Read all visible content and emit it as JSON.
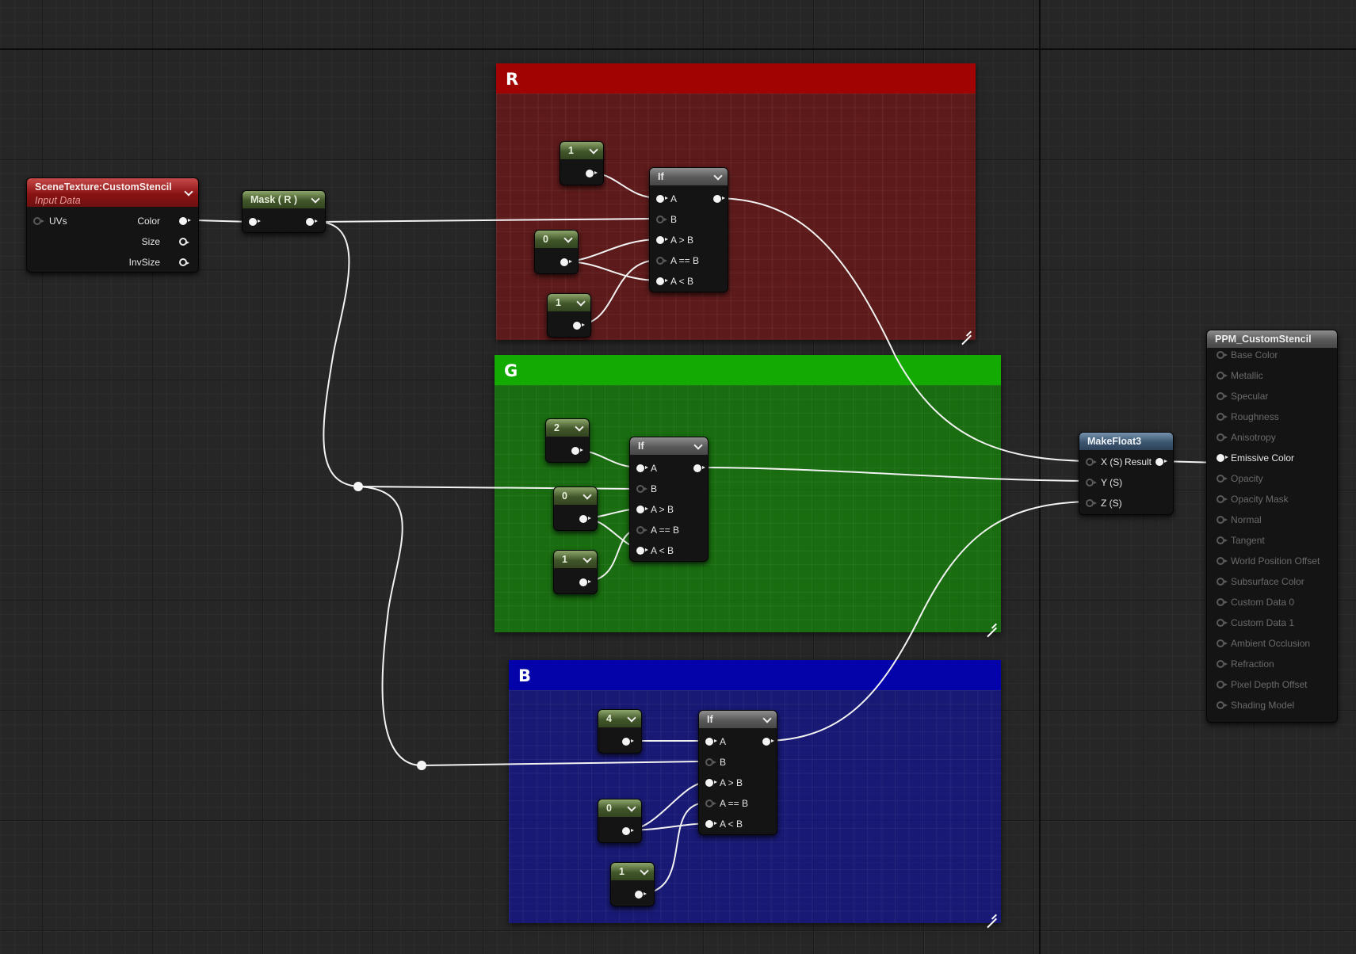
{
  "comments": {
    "red": {
      "title": "R"
    },
    "green": {
      "title": "G"
    },
    "blue": {
      "title": "B"
    }
  },
  "scene_texture": {
    "title": "SceneTexture:CustomStencil",
    "subtitle": "Input Data",
    "inputs": [
      "UVs"
    ],
    "outputs": [
      "Color",
      "Size",
      "InvSize"
    ]
  },
  "mask": {
    "title": "Mask ( R )"
  },
  "if_pins": [
    "A",
    "B",
    "A > B",
    "A == B",
    "A < B"
  ],
  "if_title": "If",
  "constants": {
    "r_const_a": "1",
    "r_const_gt": "0",
    "r_const_lt": "1",
    "g_const_a": "2",
    "g_const_gt": "0",
    "g_const_lt": "1",
    "b_const_a": "4",
    "b_const_gt": "0",
    "b_const_lt": "1"
  },
  "make_float3": {
    "title": "MakeFloat3",
    "inputs": [
      "X (S)",
      "Y (S)",
      "Z (S)"
    ],
    "output": "Result"
  },
  "material": {
    "title": "PPM_CustomStencil",
    "pins": [
      "Base Color",
      "Metallic",
      "Specular",
      "Roughness",
      "Anisotropy",
      "Emissive Color",
      "Opacity",
      "Opacity Mask",
      "Normal",
      "Tangent",
      "World Position Offset",
      "Subsurface Color",
      "Custom Data 0",
      "Custom Data 1",
      "Ambient Occlusion",
      "Refraction",
      "Pixel Depth Offset",
      "Shading Model"
    ],
    "active_pin": "Emissive Color"
  }
}
